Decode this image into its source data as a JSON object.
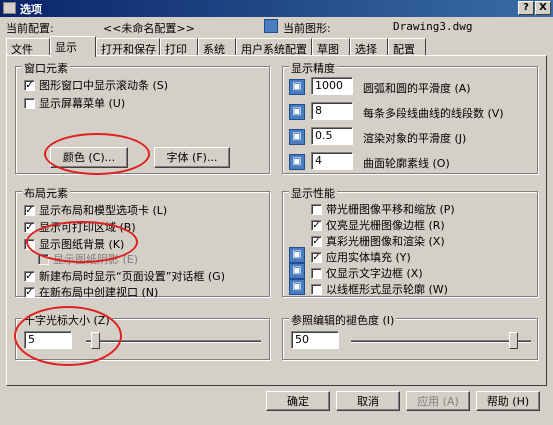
{
  "window": {
    "title": "选项",
    "help_label": "?",
    "close_label": "X"
  },
  "header": {
    "profile_label": "当前配置:",
    "profile_value": "<<未命名配置>>",
    "drawing_label": "当前图形:",
    "drawing_value": "Drawing3.dwg"
  },
  "tabs": [
    "文件",
    "显示",
    "打开和保存",
    "打印",
    "系统",
    "用户系统配置",
    "草图",
    "选择",
    "配置"
  ],
  "window_elements": {
    "title": "窗口元素",
    "scrollbars": "图形窗口中显示滚动条 (S)",
    "screen_menu": "显示屏幕菜单 (U)",
    "colors_btn": "颜色 (C)...",
    "fonts_btn": "字体 (F)..."
  },
  "layout_elements": {
    "title": "布局元素",
    "layout_tabs": "显示布局和模型选项卡 (L)",
    "printable_area": "显示可打印区域 (B)",
    "paper_bg": "显示图纸背景 (K)",
    "paper_shadow": "显示图纸阴影 (E)",
    "page_setup": "新建布局时显示“页面设置”对话框 (G)",
    "viewport": "在新布局中创建视口 (N)"
  },
  "crosshair": {
    "title": "十字光标大小 (Z)",
    "value": "5",
    "slider_fraction": 0.05
  },
  "resolution": {
    "title": "显示精度",
    "rows": [
      {
        "value": "1000",
        "label": "圆弧和圆的平滑度 (A)"
      },
      {
        "value": "8",
        "label": "每条多段线曲线的线段数 (V)"
      },
      {
        "value": "0.5",
        "label": "渲染对象的平滑度 (J)"
      },
      {
        "value": "4",
        "label": "曲面轮廓素线 (O)"
      }
    ]
  },
  "performance": {
    "title": "显示性能",
    "items": [
      {
        "label": "带光栅图像平移和缩放 (P)",
        "checked": false,
        "icon": false
      },
      {
        "label": "仅亮显光栅图像边框 (R)",
        "checked": true,
        "icon": false
      },
      {
        "label": "真彩光栅图像和渲染 (X)",
        "checked": true,
        "icon": false
      },
      {
        "label": "应用实体填充 (Y)",
        "checked": true,
        "icon": true
      },
      {
        "label": "仅显示文字边框 (X)",
        "checked": false,
        "icon": true
      },
      {
        "label": "以线框形式显示轮廓 (W)",
        "checked": false,
        "icon": true
      }
    ]
  },
  "xref": {
    "title": "参照编辑的褪色度 (I)",
    "value": "50",
    "slider_fraction": 0.9
  },
  "footer": {
    "ok": "确定",
    "cancel": "取消",
    "apply": "应用 (A)",
    "help": "帮助 (H)"
  }
}
